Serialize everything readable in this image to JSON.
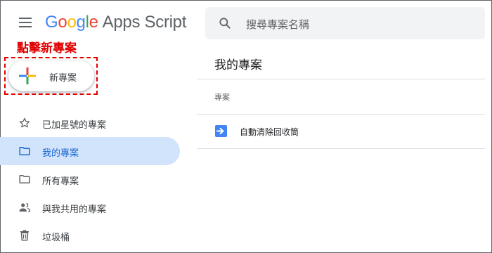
{
  "header": {
    "menu_icon": "hamburger-menu-icon",
    "logo": {
      "letters": [
        "G",
        "o",
        "o",
        "g",
        "l",
        "e"
      ],
      "product": "Apps Script"
    },
    "search": {
      "placeholder": "搜尋專案名稱",
      "icon": "search-icon"
    }
  },
  "annotation": {
    "label": "點擊新專案",
    "color": "#e10000"
  },
  "new_button": {
    "label": "新專案",
    "icon": "plus-icon"
  },
  "sidebar": {
    "items": [
      {
        "label": "已加星號的專案",
        "icon": "star-icon",
        "active": false
      },
      {
        "label": "我的專案",
        "icon": "folder-icon",
        "active": true
      },
      {
        "label": "所有專案",
        "icon": "folder-icon",
        "active": false
      },
      {
        "label": "與我共用的專案",
        "icon": "people-icon",
        "active": false
      },
      {
        "label": "垃圾桶",
        "icon": "trash-icon",
        "active": false
      }
    ]
  },
  "main": {
    "title": "我的專案",
    "section_header": "專案",
    "projects": [
      {
        "name": "自動清除回收筒",
        "icon": "apps-script-project-icon"
      }
    ]
  },
  "colors": {
    "accent": "#1967d2",
    "active_bg": "#d2e3fc",
    "project_icon": "#4285f4"
  }
}
